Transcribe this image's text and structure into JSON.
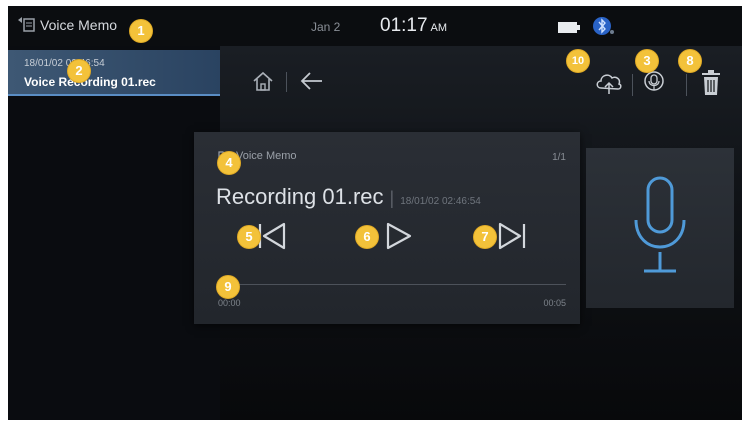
{
  "status_bar": {
    "app_title": "Voice Memo",
    "date": "Jan 2",
    "time": "01:17",
    "ampm": "AM"
  },
  "sidebar": {
    "items": [
      {
        "date": "18/01/02 02:46:54",
        "name": "Voice Recording 01.rec",
        "selected": true
      }
    ]
  },
  "toolbar": {
    "icons": [
      "home-icon",
      "back-arrow-icon",
      "cloud-upload-icon",
      "record-icon",
      "trash-icon"
    ]
  },
  "player": {
    "folder_label": "Voice Memo",
    "count": "1/1",
    "title": "Recording 01.rec",
    "separator": "|",
    "timestamp": "18/01/02 02:46:54",
    "time_start": "00:00",
    "time_end": "00:05",
    "progress": 0
  },
  "badges": [
    "1",
    "2",
    "3",
    "4",
    "5",
    "6",
    "7",
    "8",
    "9",
    "10"
  ],
  "colors": {
    "background": "#07090c",
    "accent_selected": "#3e5874",
    "badge": "#f3c23a",
    "mic": "#4f9ad8"
  }
}
